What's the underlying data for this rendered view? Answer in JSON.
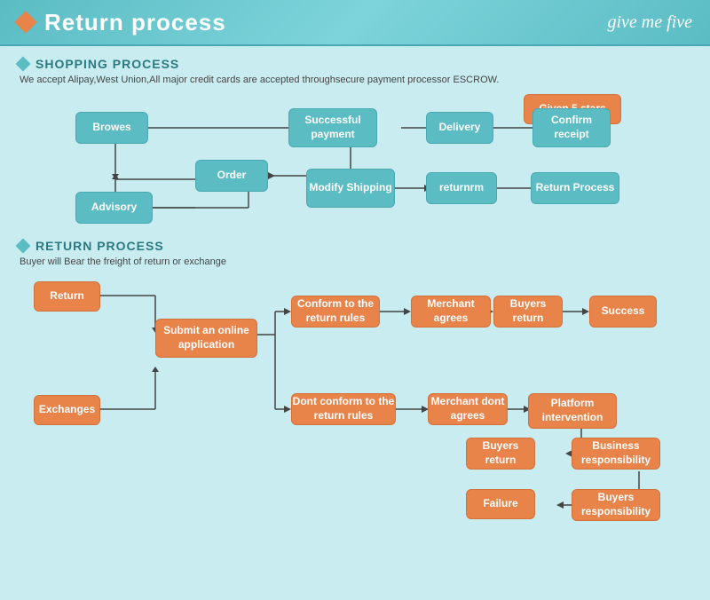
{
  "header": {
    "title": "Return process",
    "brand": "give me five",
    "diamond_color": "#e8834a"
  },
  "shopping_section": {
    "title": "SHOPPING PROCESS",
    "description": "We accept Alipay,West Union,All major credit cards are accepted throughsecure payment processor ESCROW.",
    "boxes": {
      "browes": "Browes",
      "order": "Order",
      "advisory": "Advisory",
      "modify_shipping": "Modify\nShipping",
      "successful_payment": "Successful\npayment",
      "delivery": "Delivery",
      "confirm_receipt": "Confirm\nreceipt",
      "given_5_stars": "Given 5 stars",
      "returnrm": "returnrm",
      "return_process": "Return Process"
    }
  },
  "return_section": {
    "title": "RETURN PROCESS",
    "description": "Buyer will Bear the freight of return or exchange",
    "boxes": {
      "return_btn": "Return",
      "exchanges": "Exchanges",
      "submit_online": "Submit an online\napplication",
      "conform_rules": "Conform to the\nreturn rules",
      "dont_conform": "Dont conform to the\nreturn rules",
      "merchant_agrees": "Merchant\nagrees",
      "merchant_dont": "Merchant\ndont agrees",
      "buyers_return_1": "Buyers\nreturn",
      "buyers_return_2": "Buyers\nreturn",
      "platform": "Platform\nintervention",
      "success": "Success",
      "business_resp": "Business\nresponsibility",
      "buyers_resp": "Buyers\nresponsibility",
      "failure": "Failure"
    }
  }
}
